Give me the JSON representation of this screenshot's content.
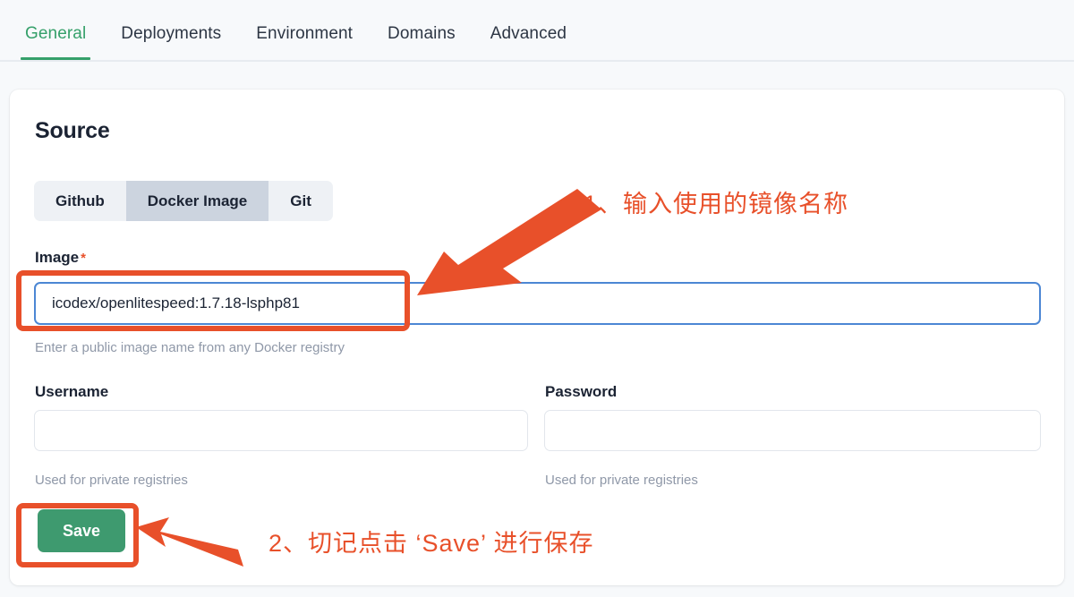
{
  "tabs": [
    {
      "label": "General",
      "active": true
    },
    {
      "label": "Deployments",
      "active": false
    },
    {
      "label": "Environment",
      "active": false
    },
    {
      "label": "Domains",
      "active": false
    },
    {
      "label": "Advanced",
      "active": false
    }
  ],
  "card": {
    "section_title": "Source",
    "source_types": [
      {
        "label": "Github",
        "selected": false
      },
      {
        "label": "Docker Image",
        "selected": true
      },
      {
        "label": "Git",
        "selected": false
      }
    ],
    "image_field": {
      "label": "Image",
      "required_marker": "*",
      "value": "icodex/openlitespeed:1.7.18-lsphp81",
      "placeholder": "",
      "helper": "Enter a public image name from any Docker registry"
    },
    "username_field": {
      "label": "Username",
      "value": "",
      "placeholder": "",
      "helper": "Used for private registries"
    },
    "password_field": {
      "label": "Password",
      "value": "",
      "placeholder": "",
      "helper": "Used for private registries"
    },
    "save_label": "Save"
  },
  "annotations": {
    "step1_text": "1、输入使用的镜像名称",
    "step2_text": "2、切记点击 ‘Save’ 进行保存"
  },
  "colors": {
    "accent_green": "#35a06a",
    "save_green": "#3e9a6f",
    "annotation_red": "#e8502a",
    "focus_blue": "#4c87d4",
    "page_bg": "#f7f9fb"
  }
}
